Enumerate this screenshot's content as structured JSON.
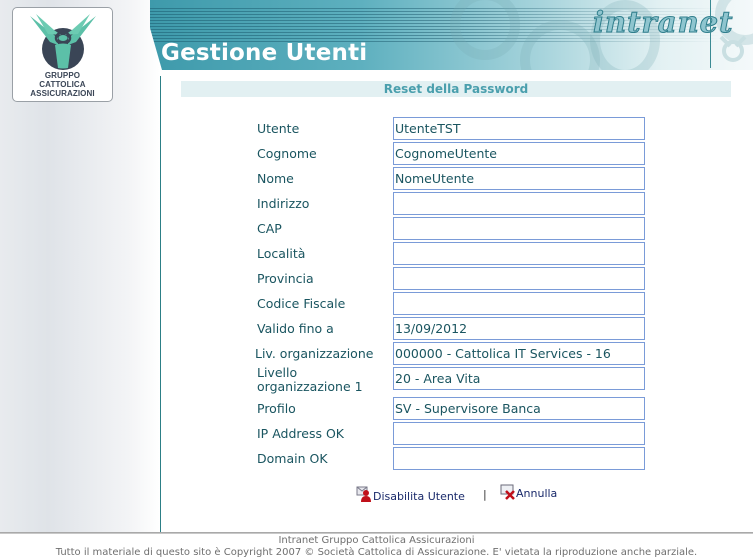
{
  "brand": {
    "logo_lines": [
      "GRUPPO",
      "CATTOLICA",
      "ASSICURAZIONI"
    ],
    "intranet_label": "intranet",
    "colors": {
      "teal": "#3e9aab",
      "logo_mint": "#5cc0a8",
      "logo_navy": "#3a4556"
    }
  },
  "header": {
    "title": "Gestione Utenti"
  },
  "section": {
    "title": "Reset della Password"
  },
  "form": {
    "fields": [
      {
        "label": "Utente",
        "value": "UtenteTST"
      },
      {
        "label": "Cognome",
        "value": "CognomeUtente"
      },
      {
        "label": "Nome",
        "value": "NomeUtente"
      },
      {
        "label": "Indirizzo",
        "value": ""
      },
      {
        "label": "CAP",
        "value": ""
      },
      {
        "label": "Località",
        "value": ""
      },
      {
        "label": "Provincia",
        "value": ""
      },
      {
        "label": "Codice Fiscale",
        "value": ""
      },
      {
        "label": "Valido fino a",
        "value": "13/09/2012"
      },
      {
        "label": "Liv. organizzazione",
        "value": "000000 - Cattolica IT Services - 16"
      },
      {
        "label": "Livello organizzazione 1",
        "value": "20 - Area Vita"
      },
      {
        "label": "Profilo",
        "value": "SV - Supervisore Banca"
      },
      {
        "label": "IP Address OK",
        "value": ""
      },
      {
        "label": "Domain OK",
        "value": ""
      }
    ]
  },
  "actions": {
    "disable_label": "Disabilita Utente",
    "disable_icon": "disable-user-icon",
    "separator": "|",
    "cancel_label": "Annulla",
    "cancel_icon": "cancel-icon"
  },
  "footer": {
    "line1": "Intranet Gruppo Cattolica Assicurazioni",
    "line2": "Tutto il materiale di questo sito è Copyright 2007 © Società Cattolica di Assicurazione. E' vietata la riproduzione anche parziale."
  }
}
